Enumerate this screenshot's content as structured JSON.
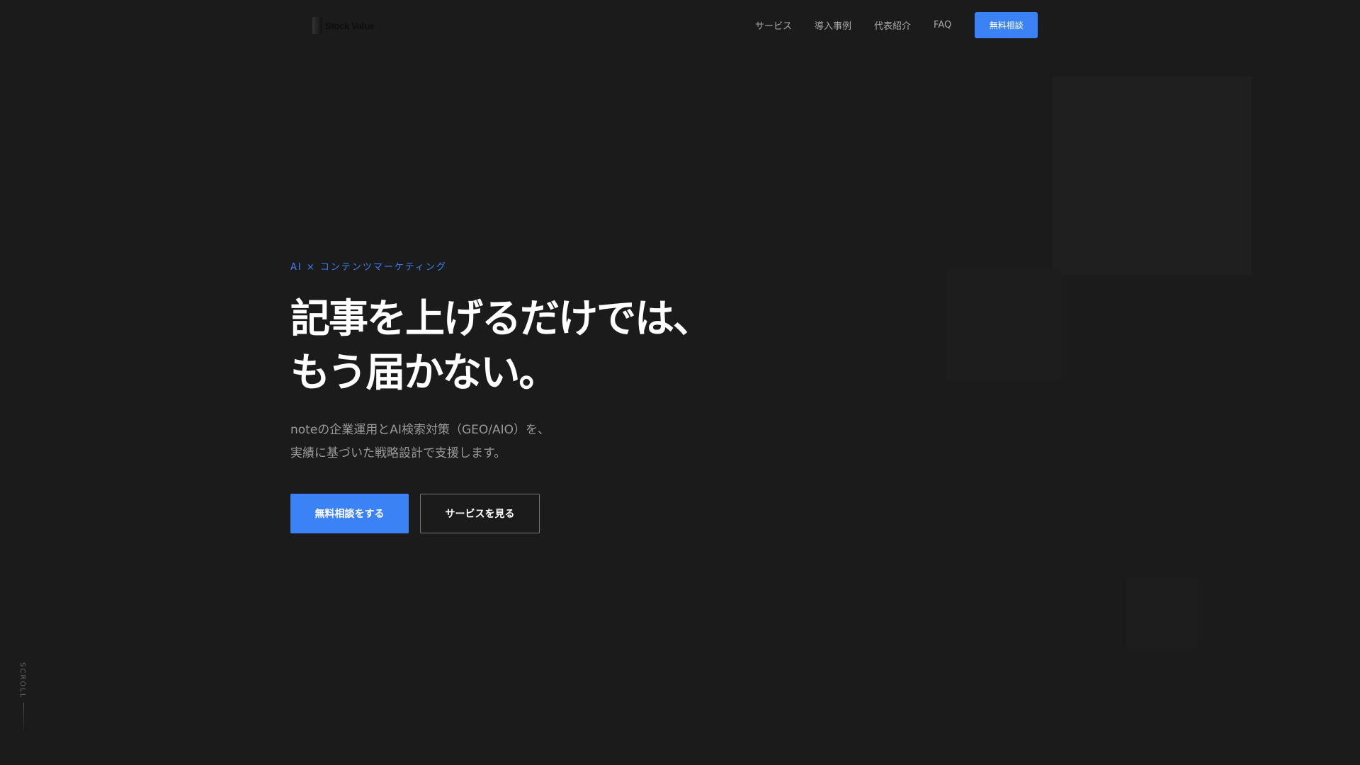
{
  "header": {
    "logo_text": "Stock Value",
    "nav": [
      "サービス",
      "導入事例",
      "代表紹介",
      "FAQ"
    ],
    "cta": "無料相談"
  },
  "hero": {
    "tag": "AI × コンテンツマーケティング",
    "title_line1": "記事を上げるだけでは、",
    "title_line2": "もう届かない。",
    "sub_line1": "noteの企業運用とAI検索対策（GEO/AIO）を、",
    "sub_line2": "実績に基づいた戦略設計で支援します。",
    "primary_button": "無料相談をする",
    "secondary_button": "サービスを見る"
  },
  "scroll": "SCROLL",
  "colors": {
    "accent": "#3b82f6",
    "background": "#1b1b1b"
  }
}
